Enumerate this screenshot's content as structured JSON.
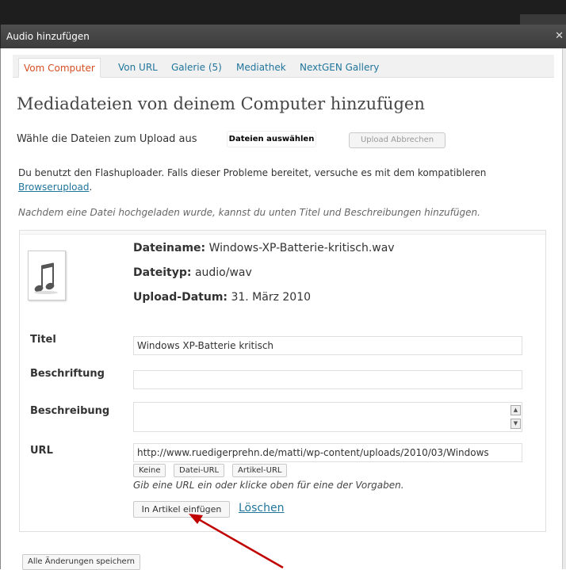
{
  "window": {
    "title": "Audio hinzufügen",
    "close_glyph": "✕"
  },
  "tabs": [
    {
      "label": "Vom Computer",
      "active": true
    },
    {
      "label": "Von URL"
    },
    {
      "label": "Galerie (5)"
    },
    {
      "label": "Mediathek"
    },
    {
      "label": "NextGEN Gallery"
    }
  ],
  "page_title": "Mediadateien von deinem Computer hinzufügen",
  "upload": {
    "choose_label": "Wähle die Dateien zum Upload aus",
    "select_button": "Dateien auswählen",
    "cancel_button": "Upload Abbrechen"
  },
  "flash_note": {
    "text": "Du benutzt den Flashuploader. Falls dieser Probleme bereitet, versuche es mit dem kompatibleren",
    "link": "Browserupload",
    "suffix": "."
  },
  "after_upload_hint": "Nachdem eine Datei hochgeladen wurde, kannst du unten Titel und Beschreibungen hinzufügen.",
  "media_item": {
    "thumbnail_icon": "audio-file-icon",
    "filename_label": "Dateiname:",
    "filename": "Windows-XP-Batterie-kritisch.wav",
    "filetype_label": "Dateityp:",
    "filetype": "audio/wav",
    "upload_date_label": "Upload-Datum:",
    "upload_date": "31. März 2010",
    "fields": {
      "title_label": "Titel",
      "title_value": "Windows XP-Batterie kritisch",
      "caption_label": "Beschriftung",
      "caption_value": "",
      "description_label": "Beschreibung",
      "description_value": "",
      "url_label": "URL",
      "url_value": "http://www.ruedigerprehn.de/matti/wp-content/uploads/2010/03/Windows"
    },
    "url_buttons": {
      "none": "Keine",
      "file_url": "Datei-URL",
      "post_url": "Artikel-URL"
    },
    "url_help": "Gib eine URL ein oder klicke oben für eine der Vorgaben.",
    "insert_button": "In Artikel einfügen",
    "delete_link": "Löschen"
  },
  "save_all_button": "Alle Änderungen speichern",
  "annotation": {
    "arrow_color": "#c00000"
  }
}
